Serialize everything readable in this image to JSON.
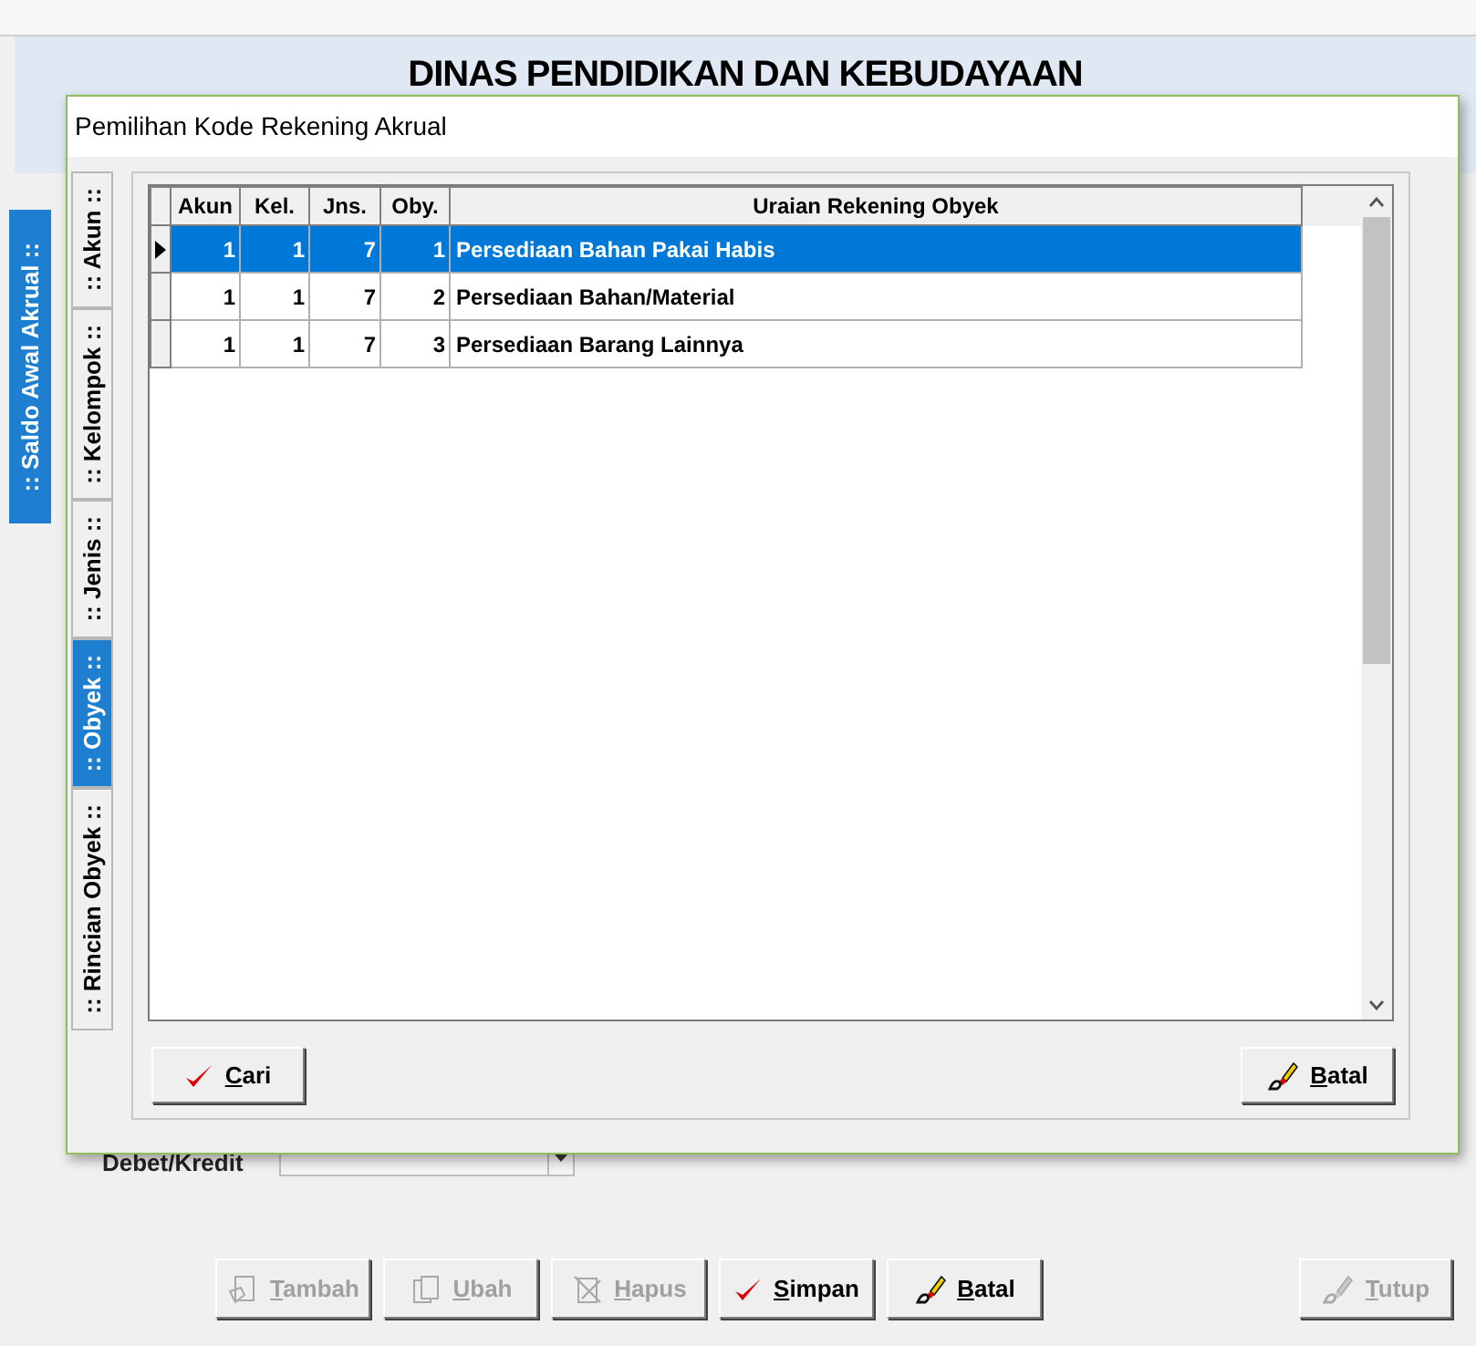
{
  "header": {
    "title": "DINAS PENDIDIKAN DAN KEBUDAYAAN"
  },
  "side_tab": {
    "label": ":: Saldo Awal Akrual ::",
    "selected": true
  },
  "dialog": {
    "title": "Pemilihan Kode Rekening Akrual",
    "tabs": [
      {
        "label": ":: Akun ::",
        "selected": false
      },
      {
        "label": ":: Kelompok ::",
        "selected": false
      },
      {
        "label": ":: Jenis ::",
        "selected": false
      },
      {
        "label": ":: Obyek ::",
        "selected": true
      },
      {
        "label": ":: Rincian Obyek ::",
        "selected": false
      }
    ],
    "table": {
      "columns": [
        "Akun",
        "Kel.",
        "Jns.",
        "Oby.",
        "Uraian Rekening Obyek"
      ],
      "rows": [
        {
          "cells": [
            "1",
            "1",
            "7",
            "1",
            "Persediaan Bahan Pakai Habis"
          ],
          "selected": true
        },
        {
          "cells": [
            "1",
            "1",
            "7",
            "2",
            "Persediaan Bahan/Material"
          ],
          "selected": false
        },
        {
          "cells": [
            "1",
            "1",
            "7",
            "3",
            "Persediaan Barang Lainnya"
          ],
          "selected": false
        }
      ]
    },
    "buttons": [
      {
        "label": "Cari",
        "kind": "check"
      },
      {
        "label": "Batal",
        "kind": "eraser"
      }
    ]
  },
  "form": {
    "field_label": "Debet/Kredit"
  },
  "buttons": [
    {
      "label": "Tambah",
      "kind": "add",
      "disabled": true
    },
    {
      "label": "Ubah",
      "kind": "edit",
      "disabled": true
    },
    {
      "label": "Hapus",
      "kind": "delete",
      "disabled": true
    },
    {
      "label": "Simpan",
      "kind": "check",
      "disabled": false
    },
    {
      "label": "Batal",
      "kind": "eraser",
      "disabled": false
    },
    {
      "label": "Tutup",
      "kind": "close",
      "disabled": true
    }
  ]
}
